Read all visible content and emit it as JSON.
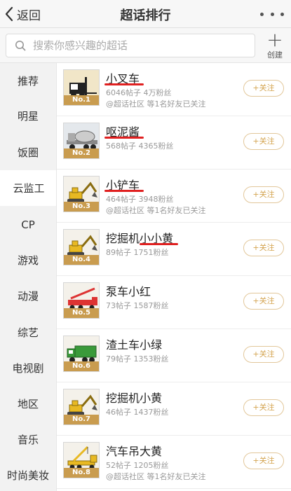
{
  "nav": {
    "back_label": "返回",
    "title": "超话排行"
  },
  "search": {
    "placeholder": "搜索你感兴趣的超话"
  },
  "create": {
    "label": "创建"
  },
  "sidebar": {
    "active_index": 3,
    "items": [
      "推荐",
      "明星",
      "饭圈",
      "云监工",
      "CP",
      "游戏",
      "动漫",
      "综艺",
      "电视剧",
      "地区",
      "音乐",
      "时尚美妆"
    ]
  },
  "colors": {
    "accent": "#d4a450",
    "rank_badge": "#c99c4f",
    "annotation": "#e02020"
  },
  "list": {
    "follow_label": "+关注",
    "items": [
      {
        "name": "小叉车",
        "rank": "No.1",
        "meta": "6046帖子  4万粉丝",
        "social": "@超话社区 等1名好友已关注",
        "icon": "forklift-icon",
        "underlined": true
      },
      {
        "name": "呕泥酱",
        "rank": "No.2",
        "meta": "568帖子  4365粉丝",
        "social": "",
        "icon": "cement-mixer-icon",
        "underlined": true
      },
      {
        "name": "小铲车",
        "rank": "No.3",
        "meta": "464帖子  3948粉丝",
        "social": "@超话社区 等1名好友已关注",
        "icon": "excavator-icon",
        "underlined": true
      },
      {
        "name": "挖掘机小小黄",
        "rank": "No.4",
        "meta": "89帖子  1751粉丝",
        "social": "",
        "icon": "excavator-icon",
        "underlined": true
      },
      {
        "name": "泵车小红",
        "rank": "No.5",
        "meta": "73帖子  1587粉丝",
        "social": "",
        "icon": "pump-truck-icon",
        "underlined": false
      },
      {
        "name": "渣土车小绿",
        "rank": "No.6",
        "meta": "79帖子  1353粉丝",
        "social": "",
        "icon": "dump-truck-icon",
        "underlined": false
      },
      {
        "name": "挖掘机小黄",
        "rank": "No.7",
        "meta": "46帖子  1437粉丝",
        "social": "",
        "icon": "excavator-icon",
        "underlined": false
      },
      {
        "name": "汽车吊大黄",
        "rank": "No.8",
        "meta": "52帖子  1205粉丝",
        "social": "@超话社区 等1名好友已关注",
        "icon": "crane-truck-icon",
        "underlined": false
      }
    ]
  }
}
